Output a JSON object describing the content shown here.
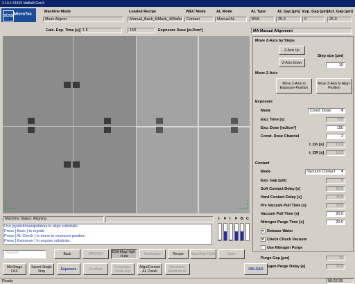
{
  "title": "2.10.1.51815 MaBaB Gen3",
  "logo": {
    "mark": "SÜSS",
    "name": "MicroTec"
  },
  "header": {
    "machine_mode_label": "Machine Mode",
    "machine_mode_value": "Mask Aligner",
    "calc_exp_time_label": "Calc. Exp. Time [s]",
    "calc_exp_time_value": "1.6",
    "loaded_recipe_label": "Loaded Recipe",
    "loaded_recipe_value": "Manual_Back_5iMask_4iWafer",
    "calc_value": "150",
    "exposure_dose_label": "Exposure Dose [mJ/cm²]",
    "wec_mode_label": "WEC Mode",
    "wec_mode_value": "Contact",
    "al_mode_label": "AL Mode",
    "al_mode_value": "Manual AL",
    "al_type_label": "AL Type",
    "al_type_value": "BSA",
    "al_gap_label": "AL Gap [µm]",
    "al_gap_value": "25.0",
    "exp_gap_label": "Exp. Gap [µm]",
    "exp_gap_value": "0",
    "act_gap_label": "Act. Gap [µm]",
    "act_gap_value": "25.0",
    "ma_mode": "MA Manual Alignment"
  },
  "zaxis": {
    "section": "Move Z-Axis by Steps",
    "up": "Z-Axis Up",
    "down": "Z-Axis Down",
    "step_size_label": "Step size  [µm]",
    "step_size_value": "10",
    "section2": "Move Z-Axis",
    "to_exposure": "Move Z-Axis to Exposure-Position",
    "to_align": "Move Z-Axis to Align-Position"
  },
  "exposure": {
    "section": "Exposure",
    "mode_label": "Mode",
    "mode_value": "Const. Dose",
    "exp_time_label": "Exp. Time [s]",
    "exp_time_value": "5.0",
    "exp_dose_label": "Exp. Dose [mJ/cm²]",
    "exp_dose_value": "150",
    "channel_label": "Const. Dose Channel",
    "channel_value": "2",
    "t_on_label": "t_On [s]",
    "t_on_value": "10.0",
    "t_off_label": "t_Off [s]",
    "t_off_value": "10.0"
  },
  "contact": {
    "section": "Contact",
    "mode_label": "Mode",
    "mode_value": "Vacuum Contact",
    "exp_gap_label": "Exp. Gap [µm]",
    "exp_gap_value": "0",
    "soft_label": "Soft Contact Delay [s]",
    "soft_value": "20.0",
    "hard_label": "Hard Contact Delay [s]",
    "hard_value": "20.0",
    "pre_vac_label": "Pre Vacuum Pull Time [s]",
    "pre_vac_value": "20.0",
    "vac_pull_label": "Vacuum Pull Time [s]",
    "vac_pull_value": "20.0",
    "n2_purge_label": "Nitrogen Purge Time [s]",
    "n2_purge_value": "20.0",
    "release_water": "Release Water",
    "check_vacuum": "Check Chuck Vacuum",
    "use_n2": "Use Nitrogen Purge",
    "purge_gap_label": "Purge Gap [µm]",
    "purge_gap_value": "10",
    "n2_delay_label": "Nitrogen Purge Delay [s]",
    "n2_delay_value": "20.0"
  },
  "status": {
    "machine_status": "Machine Status: Aligning",
    "messages": [
      "Use joystick/manipulators to align substrate.",
      "Press [ Back ] to regrab",
      "Press [ AL Check ] to move to exposure position",
      "Press [ Exposure ] to expose substrate."
    ]
  },
  "gauges": [
    {
      "label": "I",
      "level": 0.05
    },
    {
      "label": "F",
      "level": 0.55
    },
    {
      "label": "I",
      "level": 0.05
    },
    {
      "label": "F",
      "level": 0.55
    },
    {
      "label": "B",
      "level": 0.55
    },
    {
      "label": "C",
      "level": 0.0
    }
  ],
  "buttons": {
    "joystick": "Joystick",
    "back": "Back",
    "drakko": "DRAKKO",
    "bsa_mag": "BSA Mag High->Low",
    "illumination": "Illumination",
    "recipe": "Recipe",
    "start_auto_calib": "Start Auto Calib",
    "scan": "Scan",
    "mic_stage": "Mic/Stage OFF",
    "speed": "Speed Single Step",
    "exposure": "Exposure",
    "gradient": "Gradient",
    "focus": "Focus/pos. Down+Up",
    "align_contact": "Align/Contact AL Check",
    "parameter": "Parameter Assistant AL",
    "unload": "UNLOAD"
  },
  "footer": {
    "status": "Ready",
    "time": "06:02:35"
  }
}
